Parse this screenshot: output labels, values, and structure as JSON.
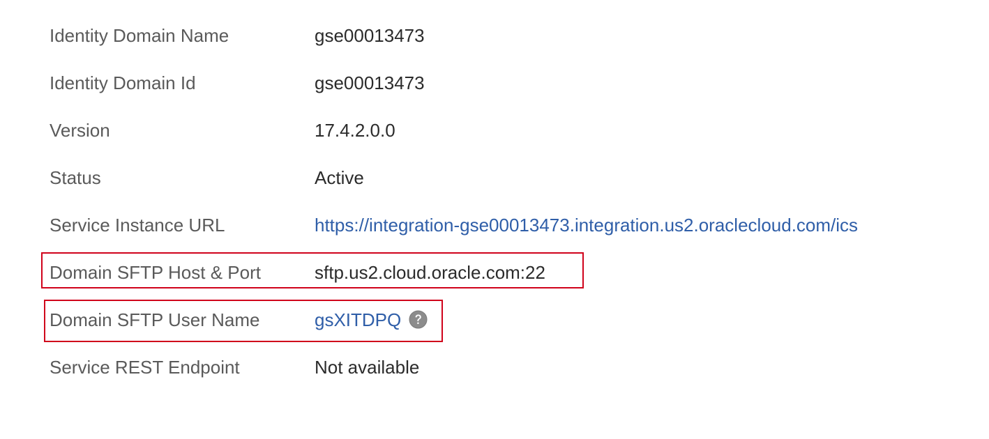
{
  "details": {
    "rows": [
      {
        "label": "Identity Domain Name",
        "value": "gse00013473"
      },
      {
        "label": "Identity Domain Id",
        "value": "gse00013473"
      },
      {
        "label": "Version",
        "value": "17.4.2.0.0"
      },
      {
        "label": "Status",
        "value": "Active"
      },
      {
        "label": "Service Instance URL",
        "value": "https://integration-gse00013473.integration.us2.oraclecloud.com/ics"
      },
      {
        "label": "Domain SFTP Host & Port",
        "value": "sftp.us2.cloud.oracle.com:22"
      },
      {
        "label": "Domain SFTP User Name",
        "value": "gsXITDPQ"
      },
      {
        "label": "Service REST Endpoint",
        "value": "Not available"
      }
    ]
  },
  "icons": {
    "sftp_user_help": "help-icon"
  },
  "colors": {
    "label": "#5a5a5a",
    "value": "#2b2b2b",
    "link": "#2f5ea8",
    "highlight": "#d0021b",
    "help_icon": "#8c8c8c"
  }
}
